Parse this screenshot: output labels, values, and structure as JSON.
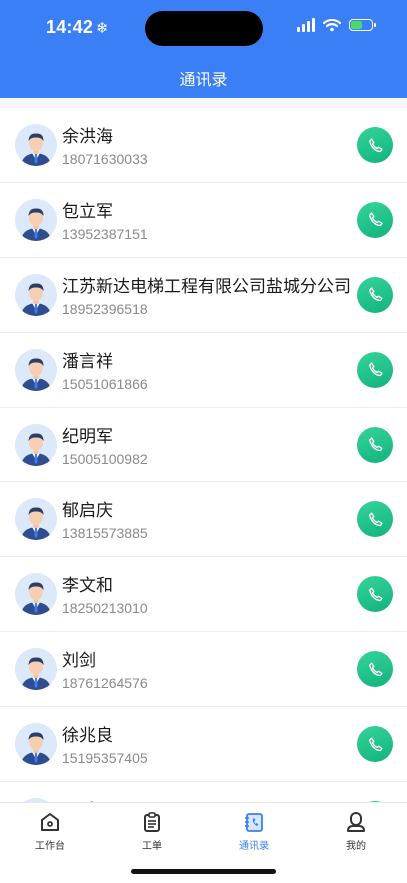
{
  "status": {
    "time": "14:42",
    "time_icon": "❄"
  },
  "header": {
    "title": "通讯录"
  },
  "contacts": [
    {
      "name": "余洪海",
      "phone": "18071630033"
    },
    {
      "name": "包立军",
      "phone": "13952387151"
    },
    {
      "name": "江苏新达电梯工程有限公司盐城分公司",
      "phone": "18952396518"
    },
    {
      "name": "潘言祥",
      "phone": "15051061866"
    },
    {
      "name": "纪明军",
      "phone": "15005100982"
    },
    {
      "name": "郁启庆",
      "phone": "13815573885"
    },
    {
      "name": "李文和",
      "phone": "18250213010"
    },
    {
      "name": "刘剑",
      "phone": "18761264576"
    },
    {
      "name": "徐兆良",
      "phone": "15195357405"
    },
    {
      "name": "王兵",
      "phone": ""
    }
  ],
  "tabbar": {
    "items": [
      {
        "label": "工作台",
        "icon": "home-icon"
      },
      {
        "label": "工单",
        "icon": "clipboard-icon"
      },
      {
        "label": "通讯录",
        "icon": "contacts-icon",
        "active": true
      },
      {
        "label": "我的",
        "icon": "profile-icon"
      }
    ]
  },
  "colors": {
    "accent": "#3a7ff5",
    "call": "#1fc28a"
  }
}
